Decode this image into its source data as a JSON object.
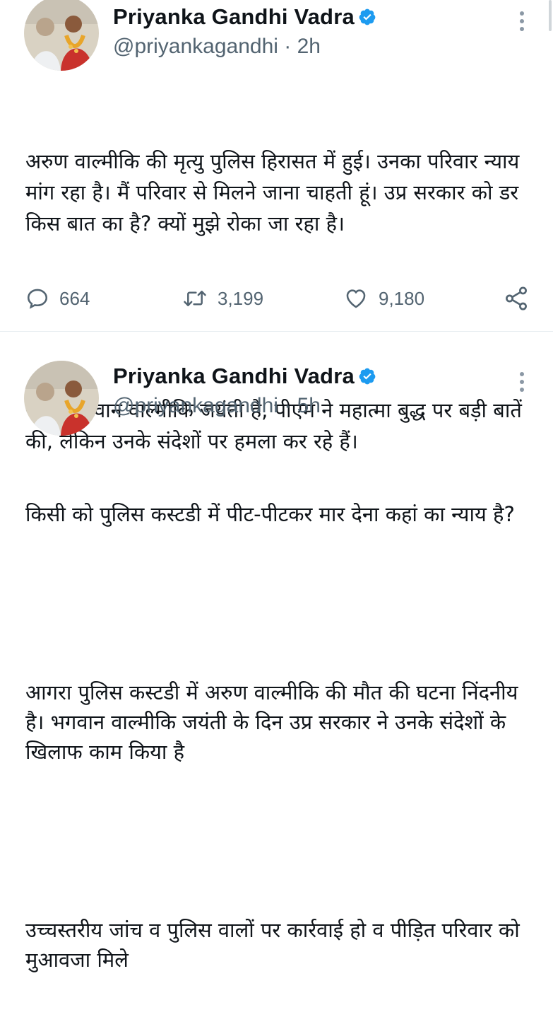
{
  "tweets": [
    {
      "author": {
        "display_name": "Priyanka Gandhi Vadra",
        "handle": "@priyankagandhi",
        "verified_icon": "verified-badge-icon",
        "avatar_icon": "profile-photo"
      },
      "time": "2h",
      "separator": "·",
      "paragraphs": [
        "अरुण वाल्मीकि की मृत्यु पुलिस हिरासत में हुई। उनका परिवार न्याय मांग रहा है। मैं परिवार से मिलने जाना चाहती हूं। उप्र सरकार को डर किस बात का है? क्यों मुझे रोका जा रहा है।",
        "आज भगवान वाल्मीकि जयंती है, पीएम ने महात्मा बुद्ध पर बड़ी बातें की, लेकिन उनके संदेशों पर हमला कर रहे हैं।"
      ],
      "actions": {
        "replies": "664",
        "retweets": "3,199",
        "likes": "9,180"
      }
    },
    {
      "author": {
        "display_name": "Priyanka Gandhi Vadra",
        "handle": "@priyankagandhi",
        "verified_icon": "verified-badge-icon",
        "avatar_icon": "profile-photo"
      },
      "time": "5h",
      "separator": "·",
      "paragraphs": [
        "किसी को पुलिस कस्टडी में पीट-पीटकर मार देना कहां का न्याय है?",
        "आगरा पुलिस कस्टडी में अरुण वाल्मीकि की मौत की घटना निंदनीय है। भगवान वाल्मीकि जयंती के दिन उप्र सरकार ने उनके संदेशों के खिलाफ काम किया है",
        "उच्चस्तरीय जांच व पुलिस वालों पर कार्रवाई हो व पीड़ित परिवार को मुआवजा मिले"
      ]
    }
  ],
  "colors": {
    "text": "#0f1419",
    "secondary": "#536471",
    "verified": "#1d9bf0",
    "divider": "#e6ecf0"
  }
}
